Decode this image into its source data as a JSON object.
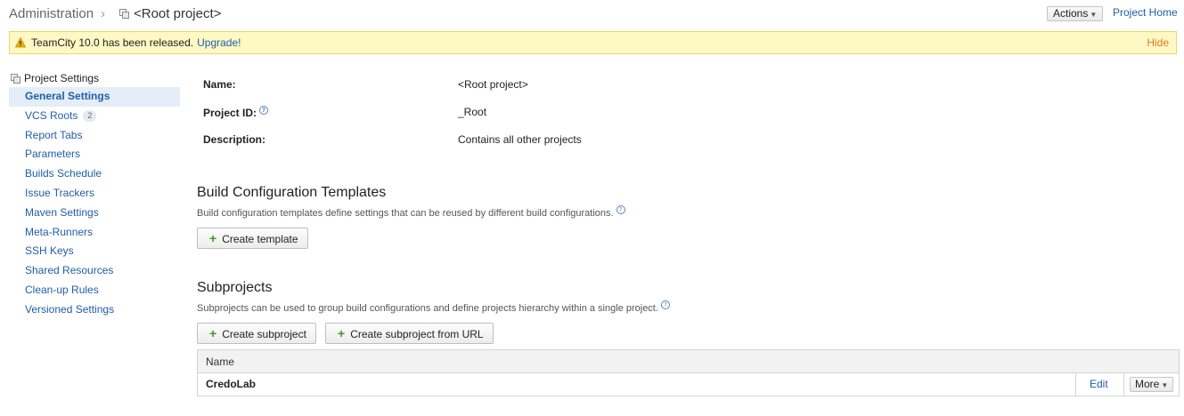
{
  "header": {
    "breadcrumb_admin": "Administration",
    "breadcrumb_sep": "›",
    "breadcrumb_project": "<Root project>",
    "actions_label": "Actions",
    "project_home_label": "Project Home"
  },
  "banner": {
    "text": "TeamCity 10.0 has been released.",
    "upgrade_label": "Upgrade!",
    "hide_label": "Hide"
  },
  "sidebar": {
    "title": "Project Settings",
    "items": [
      {
        "label": "General Settings"
      },
      {
        "label": "VCS Roots",
        "count": "2"
      },
      {
        "label": "Report Tabs"
      },
      {
        "label": "Parameters"
      },
      {
        "label": "Builds Schedule"
      },
      {
        "label": "Issue Trackers"
      },
      {
        "label": "Maven Settings"
      },
      {
        "label": "Meta-Runners"
      },
      {
        "label": "SSH Keys"
      },
      {
        "label": "Shared Resources"
      },
      {
        "label": "Clean-up Rules"
      },
      {
        "label": "Versioned Settings"
      }
    ]
  },
  "general": {
    "name_label": "Name:",
    "name_value": "<Root project>",
    "id_label": "Project ID:",
    "id_value": "_Root",
    "desc_label": "Description:",
    "desc_value": "Contains all other projects"
  },
  "templates": {
    "title": "Build Configuration Templates",
    "description": "Build configuration templates define settings that can be reused by different build configurations.",
    "create_label": "Create template"
  },
  "subprojects": {
    "title": "Subprojects",
    "description": "Subprojects can be used to group build configurations and define projects hierarchy within a single project.",
    "create_label": "Create subproject",
    "create_url_label": "Create subproject from URL",
    "table": {
      "header_name": "Name",
      "rows": [
        {
          "name": "CredoLab",
          "edit_label": "Edit",
          "more_label": "More"
        }
      ]
    }
  },
  "colors": {
    "link": "#1f5ea8",
    "banner_bg": "#fdf8c4",
    "hide_link": "#e07a1a",
    "active_item_bg": "#e4edf8",
    "plus_icon": "#3a9a2a"
  },
  "icons": {
    "project": "project-icon",
    "warning": "warning-icon",
    "help": "help-icon",
    "plus": "plus-icon",
    "caret": "chevron-down-icon"
  }
}
